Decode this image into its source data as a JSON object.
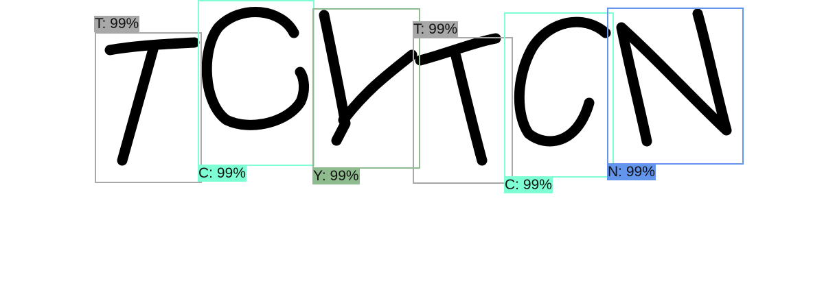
{
  "detections": [
    {
      "char": "T",
      "label": "T: 99%",
      "color": "#a8a8a8"
    },
    {
      "char": "C",
      "label": "C: 99%",
      "color": "#7fffd4"
    },
    {
      "char": "Y",
      "label": "Y: 99%",
      "color": "#8fbc8f"
    },
    {
      "char": "T",
      "label": "T: 99%",
      "color": "#a8a8a8"
    },
    {
      "char": "C",
      "label": "C: 99%",
      "color": "#7fffd4"
    },
    {
      "char": "N",
      "label": "N: 99%",
      "color": "#6495ed"
    }
  ]
}
